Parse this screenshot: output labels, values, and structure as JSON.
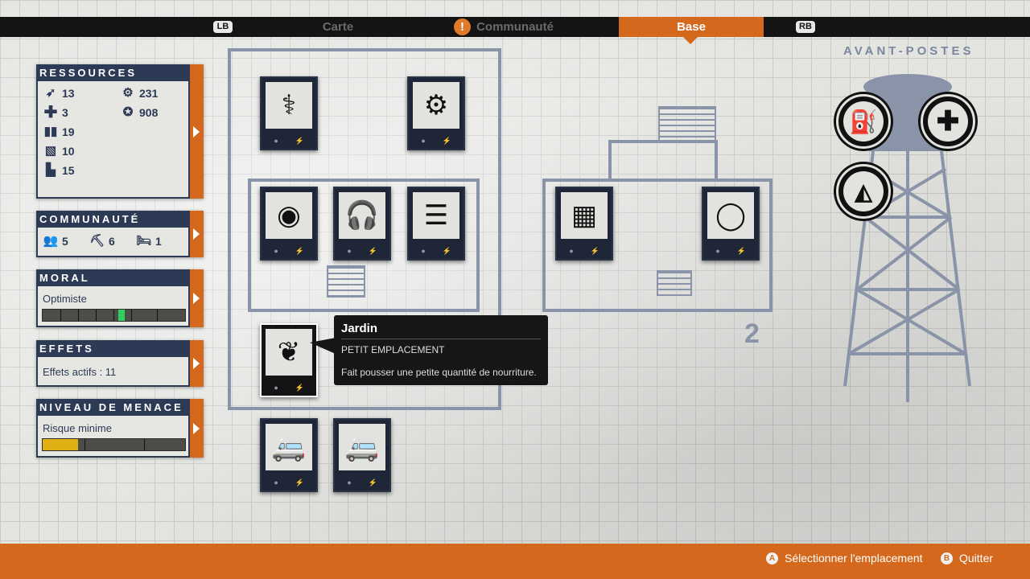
{
  "topbar": {
    "lb": "LB",
    "rb": "RB",
    "tabs": [
      "Carte",
      "Communauté",
      "Base"
    ],
    "alert": "!"
  },
  "resources": {
    "title": "RESSOURCES",
    "items": [
      {
        "icon": "ammo-icon",
        "value": "13"
      },
      {
        "icon": "medicine-icon",
        "value": "3"
      },
      {
        "icon": "food-icon",
        "value": "19"
      },
      {
        "icon": "materials-icon",
        "value": "10"
      },
      {
        "icon": "fuel-icon",
        "value": "15"
      },
      {
        "icon": "parts-icon",
        "value": "231"
      },
      {
        "icon": "influence-icon",
        "value": "908"
      }
    ]
  },
  "community": {
    "title": "COMMUNAUTÉ",
    "survivors": "5",
    "workers": "6",
    "beds": "1"
  },
  "morale": {
    "title": "MORAL",
    "status": "Optimiste",
    "level": 0.53
  },
  "effects": {
    "title": "EFFETS",
    "text": "Effets actifs : 11"
  },
  "threat": {
    "title": "NIVEAU DE MENACE",
    "status": "Risque minime",
    "level": 0.25
  },
  "slots": [
    {
      "name": "infirmary-slot",
      "icon": "stethoscope-icon"
    },
    {
      "name": "workshop-slot",
      "icon": "saw-blade-icon"
    },
    {
      "name": "bed-slot",
      "icon": "bed-icon"
    },
    {
      "name": "radio-slot",
      "icon": "headset-icon"
    },
    {
      "name": "bunks-slot",
      "icon": "bunk-bed-icon"
    },
    {
      "name": "storage-slot",
      "icon": "crates-icon"
    },
    {
      "name": "kitchen-slot",
      "icon": "plate-icon"
    },
    {
      "name": "garden-slot",
      "icon": "plant-icon"
    },
    {
      "name": "parking-slot-1",
      "icon": "vehicle-icon"
    },
    {
      "name": "parking-slot-2",
      "icon": "vehicle-icon"
    }
  ],
  "tooltip": {
    "title": "Jardin",
    "subtitle": "PETIT EMPLACEMENT",
    "description": "Fait pousser une petite quantité de nourriture."
  },
  "section_number": "2",
  "outposts": {
    "title": "AVANT-POSTES",
    "items": [
      {
        "icon": "fuel-can-icon"
      },
      {
        "icon": "medical-cross-icon"
      },
      {
        "icon": "food-slice-icon"
      }
    ]
  },
  "bottombar": {
    "select_button": "A",
    "select_label": "Sélectionner l'emplacement",
    "quit_button": "B",
    "quit_label": "Quitter"
  },
  "colors": {
    "accent": "#d4691e",
    "navy": "#2c3a55"
  }
}
